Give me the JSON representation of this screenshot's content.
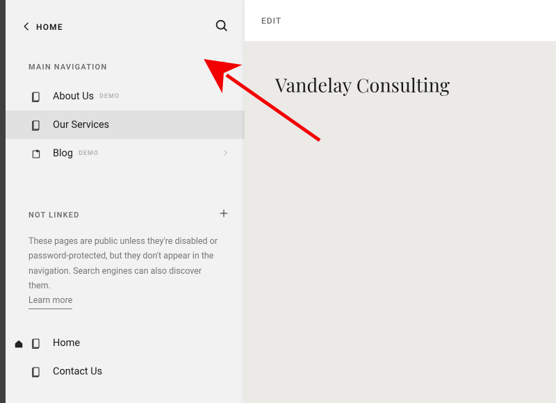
{
  "breadcrumb": {
    "label": "HOME"
  },
  "sections": {
    "main_nav": {
      "title": "MAIN NAVIGATION",
      "items": [
        {
          "label": "About Us",
          "demo": "DEMO",
          "icon": "page",
          "selected": false
        },
        {
          "label": "Our Services",
          "demo": null,
          "icon": "page",
          "selected": true
        },
        {
          "label": "Blog",
          "demo": "DEMO",
          "icon": "blog",
          "selected": false,
          "has_chevron": true
        }
      ]
    },
    "not_linked": {
      "title": "NOT LINKED",
      "description": "These pages are public unless they're disabled or password-protected, but they don't appear in the navigation. Search engines can also discover them.",
      "learn_more": "Learn more",
      "items": [
        {
          "label": "Home",
          "icon": "page",
          "is_home": true
        },
        {
          "label": "Contact Us",
          "icon": "page"
        }
      ]
    }
  },
  "preview": {
    "edit": "EDIT",
    "site_title": "Vandelay Consulting"
  },
  "annotation": {
    "type": "arrow",
    "color": "#f20000"
  }
}
